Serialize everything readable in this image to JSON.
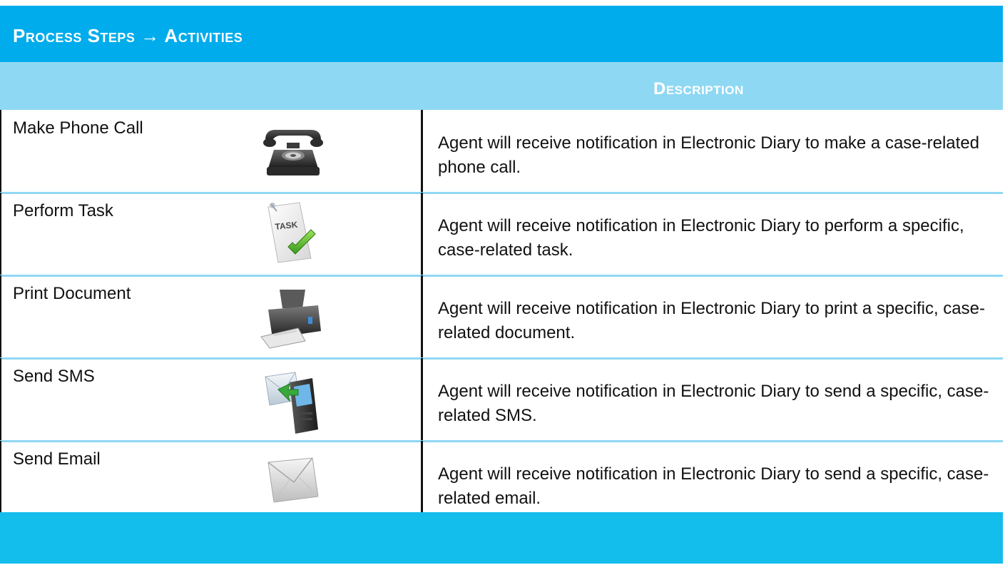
{
  "title": "Process Steps → Activities",
  "header": {
    "description_label": "Description"
  },
  "rows": [
    {
      "activity": "Make Phone Call",
      "icon": "telephone-icon",
      "description": "Agent will receive notification in Electronic Diary to make a case-related phone call."
    },
    {
      "activity": "Perform Task",
      "icon": "task-check-icon",
      "description": "Agent will receive notification in Electronic Diary to perform a specific, case-related task."
    },
    {
      "activity": "Print Document",
      "icon": "printer-icon",
      "description": "Agent will receive notification in Electronic Diary to print a specific, case-related document."
    },
    {
      "activity": "Send SMS",
      "icon": "mobile-sms-icon",
      "description": "Agent will receive notification in Electronic Diary to send a specific, case-related SMS."
    },
    {
      "activity": "Send Email",
      "icon": "envelope-icon",
      "description": "Agent will receive notification in Electronic Diary to send a specific, case-related email."
    }
  ],
  "colors": {
    "title_bar": "#00acec",
    "header_bar": "#8fd8f4",
    "footer_bar": "#13bdec",
    "divider": "#111111"
  }
}
